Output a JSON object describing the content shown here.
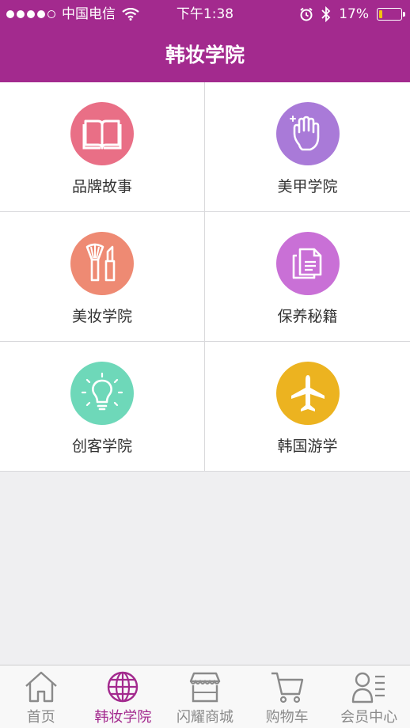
{
  "status_bar": {
    "carrier": "中国电信",
    "time": "下午1:38",
    "battery_percent": "17%",
    "battery_level": 0.17,
    "signal_bars": 4
  },
  "header": {
    "title": "韩妆学院",
    "background_color": "#a32a8e"
  },
  "grid": {
    "items": [
      {
        "label": "品牌故事",
        "icon": "book-icon",
        "color": "#e96f86"
      },
      {
        "label": "美甲学院",
        "icon": "hand-icon",
        "color": "#a97ad8"
      },
      {
        "label": "美妆学院",
        "icon": "makeup-brush-icon",
        "color": "#ee8a73"
      },
      {
        "label": "保养秘籍",
        "icon": "document-icon",
        "color": "#c970d6"
      },
      {
        "label": "创客学院",
        "icon": "lightbulb-icon",
        "color": "#6ed8b9"
      },
      {
        "label": "韩国游学",
        "icon": "airplane-icon",
        "color": "#ecb320"
      }
    ]
  },
  "tabbar": {
    "active_color": "#a32a8e",
    "inactive_color": "#8a8a8a",
    "tabs": [
      {
        "label": "首页",
        "icon": "home-icon",
        "active": false
      },
      {
        "label": "韩妆学院",
        "icon": "globe-icon",
        "active": true
      },
      {
        "label": "闪耀商城",
        "icon": "store-icon",
        "active": false
      },
      {
        "label": "购物车",
        "icon": "cart-icon",
        "active": false
      },
      {
        "label": "会员中心",
        "icon": "member-icon",
        "active": false
      }
    ]
  }
}
